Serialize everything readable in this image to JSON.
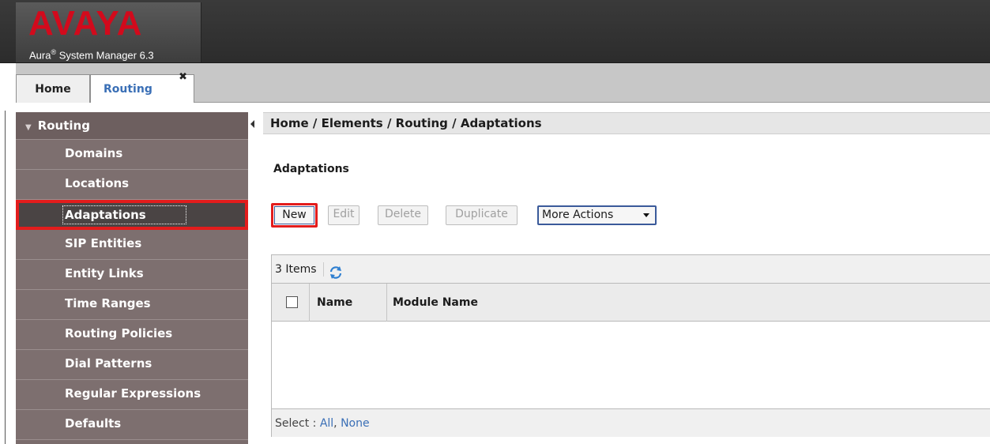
{
  "header": {
    "logo_text": "AVAYA",
    "product_prefix": "Aura",
    "product_reg": "®",
    "product_name": " System Manager 6.3"
  },
  "tabs": [
    {
      "label": "Home"
    },
    {
      "label": "Routing",
      "close": "✖"
    }
  ],
  "sidebar": {
    "title": "Routing",
    "items": [
      {
        "label": "Domains"
      },
      {
        "label": "Locations"
      },
      {
        "label": "Adaptations"
      },
      {
        "label": "SIP Entities"
      },
      {
        "label": "Entity Links"
      },
      {
        "label": "Time Ranges"
      },
      {
        "label": "Routing Policies"
      },
      {
        "label": "Dial Patterns"
      },
      {
        "label": "Regular Expressions"
      },
      {
        "label": "Defaults"
      }
    ],
    "active": "Adaptations"
  },
  "breadcrumb": "Home / Elements / Routing / Adaptations",
  "page_title": "Adaptations",
  "toolbar": {
    "new_label": "New",
    "edit_label": "Edit",
    "delete_label": "Delete",
    "duplicate_label": "Duplicate",
    "more_actions_label": "More Actions"
  },
  "table": {
    "item_count": "3 Items",
    "columns": [
      "Name",
      "Module Name"
    ],
    "select_prefix": "Select : ",
    "select_all": "All",
    "select_sep": ",",
    "select_none": "None"
  },
  "colors": {
    "highlight": "#e31c1c",
    "brand_red": "#d20a1c",
    "link": "#3a6fb6",
    "sidebar": "#7d6f6f"
  }
}
